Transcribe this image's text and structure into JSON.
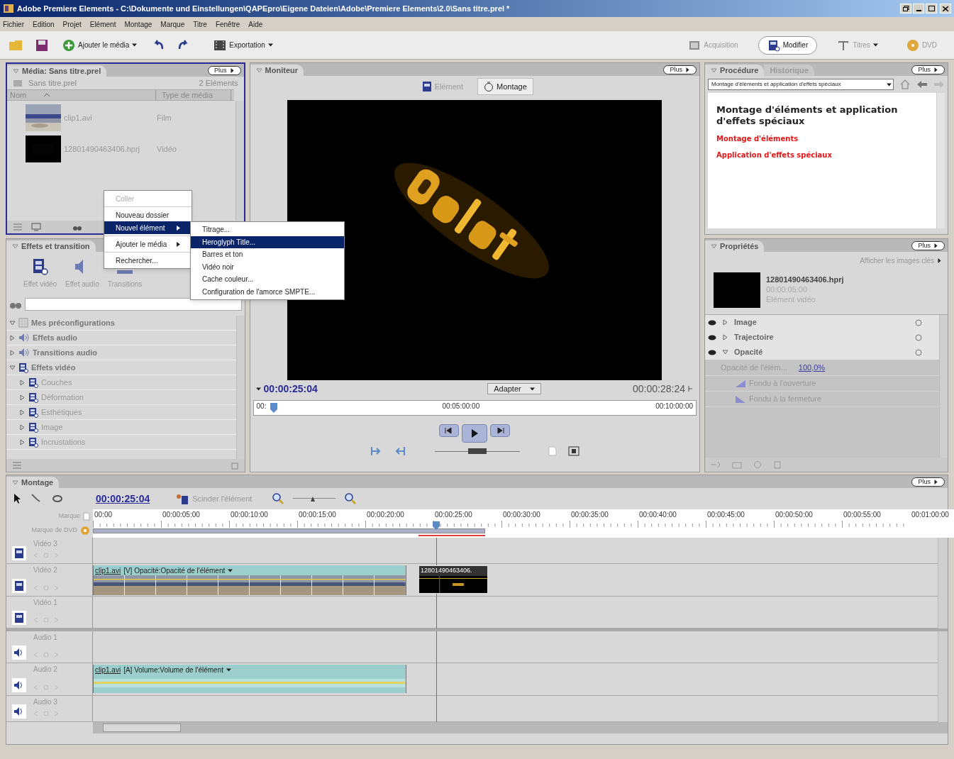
{
  "window": {
    "title": "Adobe Premiere Elements - C:\\Dokumente und Einstellungen\\QAPEpro\\Eigene Dateien\\Adobe\\Premiere Elements\\2.0\\Sans titre.prel *"
  },
  "menu_bar": [
    "Fichier",
    "Edition",
    "Projet",
    "Elément",
    "Montage",
    "Marque",
    "Titre",
    "Fenêtre",
    "Aide"
  ],
  "toolbar": {
    "add_media": "Ajouter le média",
    "export": "Exportation",
    "modes": [
      {
        "label": "Acquisition",
        "selected": false,
        "kind": "capture"
      },
      {
        "label": "Modifier",
        "selected": true,
        "kind": "edit"
      },
      {
        "label": "Titres",
        "selected": false,
        "kind": "titles"
      },
      {
        "label": "DVD",
        "selected": false,
        "kind": "dvd"
      }
    ]
  },
  "media_panel": {
    "tab": "Média: Sans titre.prel",
    "more": "Plus",
    "focused": true,
    "project": "Sans titre.prel",
    "count": "2 Eléments",
    "columns": [
      "Nom",
      "Type de média"
    ],
    "items": [
      {
        "name": "clip1.avi",
        "type": "Film"
      },
      {
        "name": "12801490463406.hprj",
        "type": "Vidéo"
      }
    ]
  },
  "context_menu": {
    "groups": [
      [
        {
          "label": "Coller",
          "disabled": true,
          "selected": false,
          "submenu": false
        }
      ],
      [
        {
          "label": "Nouveau dossier",
          "disabled": false,
          "selected": false,
          "submenu": false
        },
        {
          "label": "Nouvel élément",
          "disabled": false,
          "selected": true,
          "submenu": true
        }
      ],
      [
        {
          "label": "Ajouter le média",
          "disabled": false,
          "selected": false,
          "submenu": true
        }
      ],
      [
        {
          "label": "Rechercher...",
          "disabled": false,
          "selected": false,
          "submenu": false
        }
      ]
    ]
  },
  "submenu": {
    "items": [
      {
        "label": "Titrage...",
        "selected": false
      },
      {
        "label": "Heroglyph Title...",
        "selected": true
      },
      {
        "label": "Barres et ton",
        "selected": false
      },
      {
        "label": "Vidéo noir",
        "selected": false
      },
      {
        "label": "Cache couleur...",
        "selected": false
      },
      {
        "label": "Configuration de l'amorce SMPTE...",
        "selected": false
      }
    ]
  },
  "effects_panel": {
    "tab": "Effets et transition",
    "categories": [
      {
        "label": "Effet vidéo",
        "kind": "video"
      },
      {
        "label": "Effet audio",
        "kind": "audio"
      },
      {
        "label": "Transitions",
        "kind": "transition"
      }
    ],
    "tree": [
      {
        "label": "Mes préconfigurations",
        "kind": "preset",
        "expanded": true
      },
      {
        "label": "Effets audio",
        "kind": "audio",
        "expanded": false
      },
      {
        "label": "Transitions audio",
        "kind": "audio",
        "expanded": false
      },
      {
        "label": "Effets vidéo",
        "kind": "video",
        "expanded": true,
        "children": [
          {
            "label": "Couches",
            "kind": "video",
            "expanded": false
          },
          {
            "label": "Déformation",
            "kind": "video",
            "expanded": false
          },
          {
            "label": "Esthétiques",
            "kind": "video",
            "expanded": false
          },
          {
            "label": "Image",
            "kind": "video",
            "expanded": false
          },
          {
            "label": "Incrustations",
            "kind": "video",
            "expanded": false
          }
        ]
      }
    ]
  },
  "monitor": {
    "tab": "Moniteur",
    "more": "Plus",
    "views": [
      {
        "label": "Elément",
        "selected": false
      },
      {
        "label": "Montage",
        "selected": true
      }
    ],
    "current_time": "00:00:25:04",
    "zoom": "Adapter",
    "duration": "00:00:28:24",
    "ruler": [
      "00:",
      "00:05:00:00",
      "00:10:00:00"
    ],
    "shuttle": {
      "level": 0.5
    }
  },
  "procedure": {
    "tabs": [
      {
        "label": "Procédure",
        "selected": true
      },
      {
        "label": "Historique",
        "selected": false
      }
    ],
    "more": "Plus",
    "topic": "Montage d'éléments et application d'effets spéciaux",
    "heading": "Montage d'éléments et application d'effets spéciaux",
    "links": [
      "Montage d'éléments",
      "Application d'effets spéciaux"
    ]
  },
  "properties": {
    "tab": "Propriétés",
    "more": "Plus",
    "keyframes": "Afficher les images clés",
    "clip": {
      "name": "12801490463406.hprj",
      "duration": "00:00:05:00",
      "type": "Elément vidéo"
    },
    "effects": [
      {
        "label": "Image",
        "expanded": false
      },
      {
        "label": "Trajectoire",
        "expanded": false
      },
      {
        "label": "Opacité",
        "expanded": true
      }
    ],
    "param": {
      "label": "Opacité de l'élém...",
      "value": "100,0%"
    },
    "fades": [
      {
        "label": "Fondu à l'ouverture",
        "kind": "in"
      },
      {
        "label": "Fondu à la fermeture",
        "kind": "out"
      }
    ]
  },
  "timeline": {
    "tab": "Montage",
    "more": "Plus",
    "time": "00:00:25:04",
    "split": "Scinder l'élément",
    "zoom_slider": {
      "level": 0.45
    },
    "marker": "Marque",
    "dvd_marker": "Marque de DVD",
    "ruler": [
      "00:00",
      "00:00:05:00",
      "00:00:10:00",
      "00:00:15:00",
      "00:00:20:00",
      "00:00:25:00",
      "00:00:30:00",
      "00:00:35:00",
      "00:00:40:00",
      "00:00:45:00",
      "00:00:50:00",
      "00:00:55:00",
      "00:01:00:00"
    ],
    "tracks": [
      {
        "name": "Vidéo 3",
        "kind": "video"
      },
      {
        "name": "Vidéo 2",
        "kind": "video",
        "clips": [
          {
            "name": "clip1.avi",
            "label": "[V] Opacité:Opacité de l'élément",
            "kind": "video"
          },
          {
            "name": "12801490463406.",
            "kind": "title"
          }
        ]
      },
      {
        "name": "Vidéo 1",
        "kind": "video"
      },
      {
        "name": "Audio 1",
        "kind": "audio"
      },
      {
        "name": "Audio 2",
        "kind": "audio",
        "clips": [
          {
            "name": "clip1.avi",
            "label": "[A] Volume:Volume de l'élément",
            "kind": "audio"
          }
        ]
      },
      {
        "name": "Audio 3",
        "kind": "audio"
      }
    ]
  }
}
